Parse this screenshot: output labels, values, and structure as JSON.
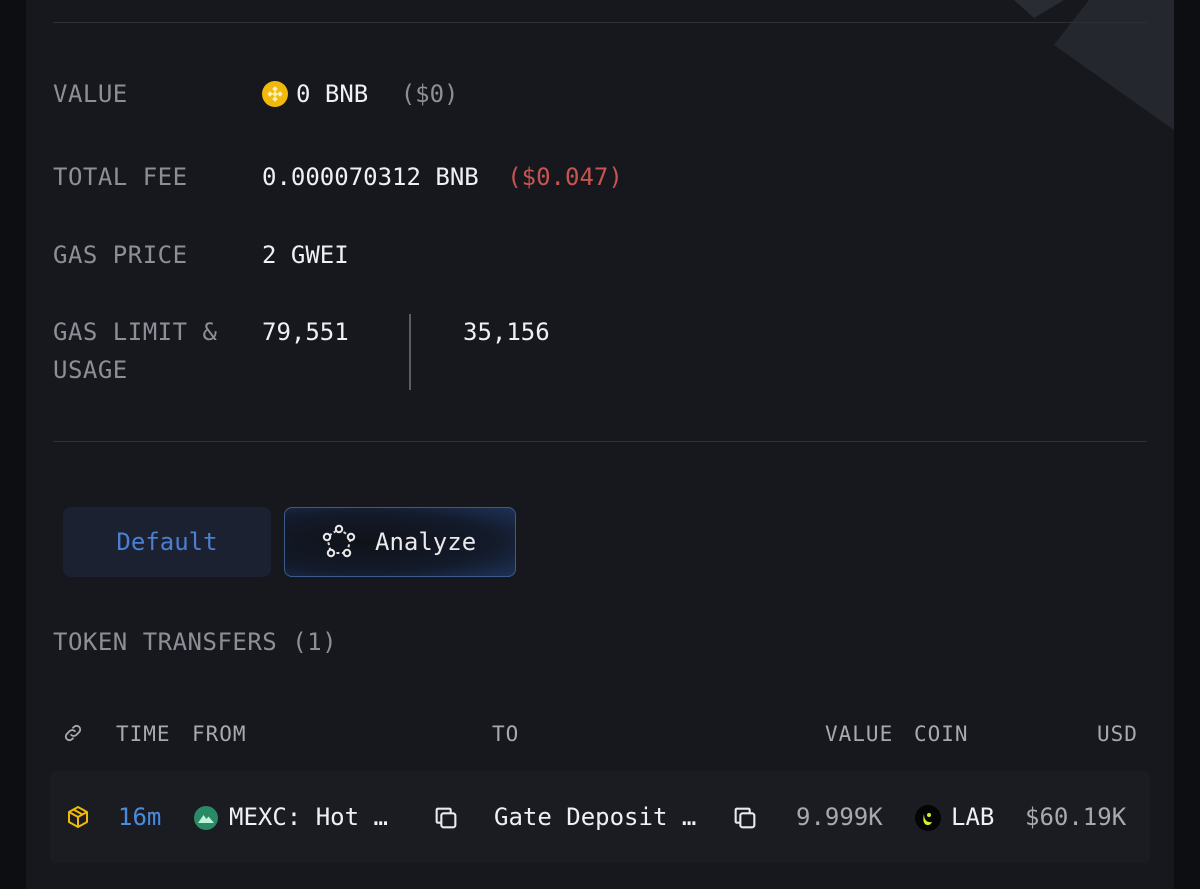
{
  "details": {
    "value": {
      "label": "VALUE",
      "amount": "0 BNB",
      "usd": "($0)"
    },
    "total_fee": {
      "label": "TOTAL FEE",
      "amount": "0.000070312 BNB",
      "usd": "($0.047)"
    },
    "gas_price": {
      "label": "GAS PRICE",
      "amount": "2 GWEI"
    },
    "gas_limit_usage": {
      "label_line1": "GAS LIMIT &",
      "label_line2": "USAGE",
      "limit": "79,551",
      "usage": "35,156"
    }
  },
  "view_tabs": {
    "default_label": "Default",
    "analyze_label": "Analyze"
  },
  "token_transfers": {
    "title": "TOKEN TRANSFERS (1)",
    "columns": {
      "time": "TIME",
      "from": "FROM",
      "to": "TO",
      "value": "VALUE",
      "coin": "COIN",
      "usd": "USD"
    },
    "rows": [
      {
        "time": "16m",
        "from": "MEXC: Hot …",
        "to": "Gate Deposit …",
        "value": "9.999K",
        "coin": "LAB",
        "usd": "$60.19K"
      }
    ]
  },
  "colors": {
    "accent_blue": "#4a8be0",
    "fee_red": "#c75450",
    "bnb_yellow": "#f0b90b",
    "mexc_green": "#2b8a66"
  },
  "icons": [
    "bnb-coin-icon",
    "analyze-icon",
    "link-icon",
    "chain-cube-icon",
    "mexc-logo-icon",
    "copy-icon",
    "lab-coin-icon"
  ]
}
